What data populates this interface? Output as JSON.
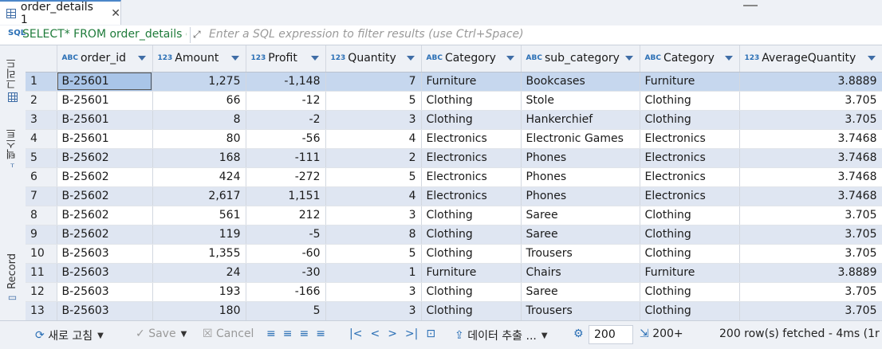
{
  "tab": {
    "title": "order_details 1"
  },
  "filter": {
    "sql_tag": "SQL",
    "sql": "SELECT* FROM order_details c",
    "placeholder": "Enter a SQL expression to filter results (use Ctrl+Space)"
  },
  "side_tabs": {
    "grid": "그리드",
    "text": "텍스트",
    "record": "Record"
  },
  "columns": [
    {
      "type": "ABC",
      "name": "order_id"
    },
    {
      "type": "123",
      "name": "Amount"
    },
    {
      "type": "123",
      "name": "Profit"
    },
    {
      "type": "123",
      "name": "Quantity"
    },
    {
      "type": "ABC",
      "name": "Category"
    },
    {
      "type": "ABC",
      "name": "sub_category"
    },
    {
      "type": "ABC",
      "name": "Category"
    },
    {
      "type": "123",
      "name": "AverageQuantity"
    }
  ],
  "rows": [
    [
      "1",
      "B-25601",
      "1,275",
      "-1,148",
      "7",
      "Furniture",
      "Bookcases",
      "Furniture",
      "3.8889"
    ],
    [
      "2",
      "B-25601",
      "66",
      "-12",
      "5",
      "Clothing",
      "Stole",
      "Clothing",
      "3.705"
    ],
    [
      "3",
      "B-25601",
      "8",
      "-2",
      "3",
      "Clothing",
      "Hankerchief",
      "Clothing",
      "3.705"
    ],
    [
      "4",
      "B-25601",
      "80",
      "-56",
      "4",
      "Electronics",
      "Electronic Games",
      "Electronics",
      "3.7468"
    ],
    [
      "5",
      "B-25602",
      "168",
      "-111",
      "2",
      "Electronics",
      "Phones",
      "Electronics",
      "3.7468"
    ],
    [
      "6",
      "B-25602",
      "424",
      "-272",
      "5",
      "Electronics",
      "Phones",
      "Electronics",
      "3.7468"
    ],
    [
      "7",
      "B-25602",
      "2,617",
      "1,151",
      "4",
      "Electronics",
      "Phones",
      "Electronics",
      "3.7468"
    ],
    [
      "8",
      "B-25602",
      "561",
      "212",
      "3",
      "Clothing",
      "Saree",
      "Clothing",
      "3.705"
    ],
    [
      "9",
      "B-25602",
      "119",
      "-5",
      "8",
      "Clothing",
      "Saree",
      "Clothing",
      "3.705"
    ],
    [
      "10",
      "B-25603",
      "1,355",
      "-60",
      "5",
      "Clothing",
      "Trousers",
      "Clothing",
      "3.705"
    ],
    [
      "11",
      "B-25603",
      "24",
      "-30",
      "1",
      "Furniture",
      "Chairs",
      "Furniture",
      "3.8889"
    ],
    [
      "12",
      "B-25603",
      "193",
      "-166",
      "3",
      "Clothing",
      "Saree",
      "Clothing",
      "3.705"
    ],
    [
      "13",
      "B-25603",
      "180",
      "5",
      "3",
      "Clothing",
      "Trousers",
      "Clothing",
      "3.705"
    ]
  ],
  "toolbar": {
    "refresh": "새로 고침",
    "save": "Save",
    "cancel": "Cancel",
    "export": "데이터 추출 ...",
    "fetch_size": "200",
    "fetch_more": "200+",
    "status": "200 row(s) fetched - 4ms (1r"
  },
  "icons": {
    "tab": "table-icon",
    "close": "close-icon",
    "expand": "expand-icon",
    "sort": "chevron-down-icon",
    "refresh": "refresh-icon",
    "save": "check-icon",
    "cancel": "cancel-icon",
    "first": "first-page-icon",
    "prev": "prev-icon",
    "next": "next-icon",
    "last": "last-page-icon",
    "export": "export-icon",
    "settings": "gear-icon",
    "fetch": "fetch-more-icon"
  }
}
